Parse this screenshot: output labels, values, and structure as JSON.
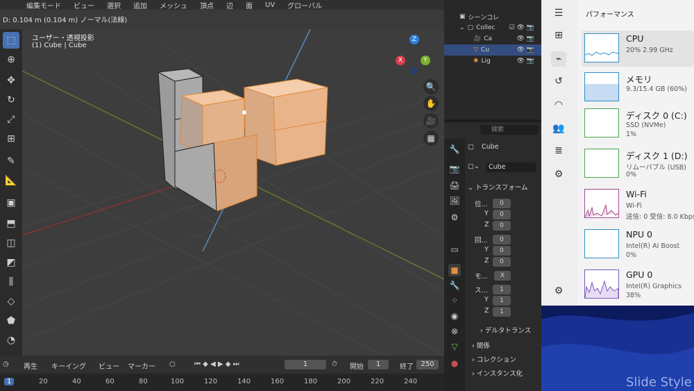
{
  "header": {
    "mode": "編集モード",
    "menu": [
      "ビュー",
      "選択",
      "追加",
      "メッシュ",
      "頂点",
      "辺",
      "面",
      "UV"
    ],
    "orientation": "グローバル"
  },
  "status": {
    "text": "D: 0.104 m (0.104 m) ノーマル(法線)"
  },
  "viewport": {
    "view_label": "ユーザー・透視投影",
    "object_label": "(1) Cube | Cube",
    "gizmo": {
      "x": "X",
      "y": "Y",
      "z": "Z"
    }
  },
  "timeline": {
    "playback": "再生",
    "keying": "キーイング",
    "view": "ビュー",
    "marker": "マーカー",
    "current_frame": "1",
    "start_label": "開始",
    "start": "1",
    "end_label": "終了",
    "end": "250",
    "ruler": [
      "1",
      "20",
      "40",
      "60",
      "80",
      "100",
      "120",
      "140",
      "160",
      "180",
      "200",
      "220",
      "240"
    ]
  },
  "outliner": {
    "scene": "シーンコレ",
    "rows": [
      {
        "label": "Collec"
      },
      {
        "label": "Ca"
      },
      {
        "label": "Cu"
      },
      {
        "label": "Lig"
      }
    ]
  },
  "properties": {
    "search_placeholder": "検索",
    "object_name": "Cube",
    "mesh_name": "Cube",
    "transform_header": "トランスフォーム",
    "location_label": "位...",
    "rotation_label": "回...",
    "mode_label": "モ...",
    "mode_value": "X",
    "scale_label": "ス...",
    "location": [
      "0",
      "0",
      "0"
    ],
    "rotation": [
      "0",
      "0",
      "0"
    ],
    "scale": [
      "1",
      "1",
      "1"
    ],
    "axis_y": "Y",
    "axis_z": "Z",
    "delta": "デルタトランス",
    "relations": "関係",
    "collections": "コレクション",
    "instancing": "インスタンス化"
  },
  "task_manager": {
    "title": "パフォーマンス",
    "items": [
      {
        "name": "CPU",
        "sub1": "20%  2.99 GHz",
        "sub2": ""
      },
      {
        "name": "メモリ",
        "sub1": "9.3/15.4 GB (60%)",
        "sub2": ""
      },
      {
        "name": "ディスク 0 (C:)",
        "sub1": "SSD (NVMe)",
        "sub2": "1%"
      },
      {
        "name": "ディスク 1 (D:)",
        "sub1": "リムーバブル (USB)",
        "sub2": "0%"
      },
      {
        "name": "Wi-Fi",
        "sub1": "Wi-Fi",
        "sub2": "送信: 0  受信: 8.0 Kbps"
      },
      {
        "name": "NPU 0",
        "sub1": "Intel(R) AI Boost",
        "sub2": "0%"
      },
      {
        "name": "GPU 0",
        "sub1": "Intel(R) Graphics",
        "sub2": "38%"
      }
    ]
  },
  "watermark": "Slide Style",
  "colors": {
    "accent": "#4772b3",
    "selection": "#e8a060",
    "bg": "#3d3d3d"
  }
}
